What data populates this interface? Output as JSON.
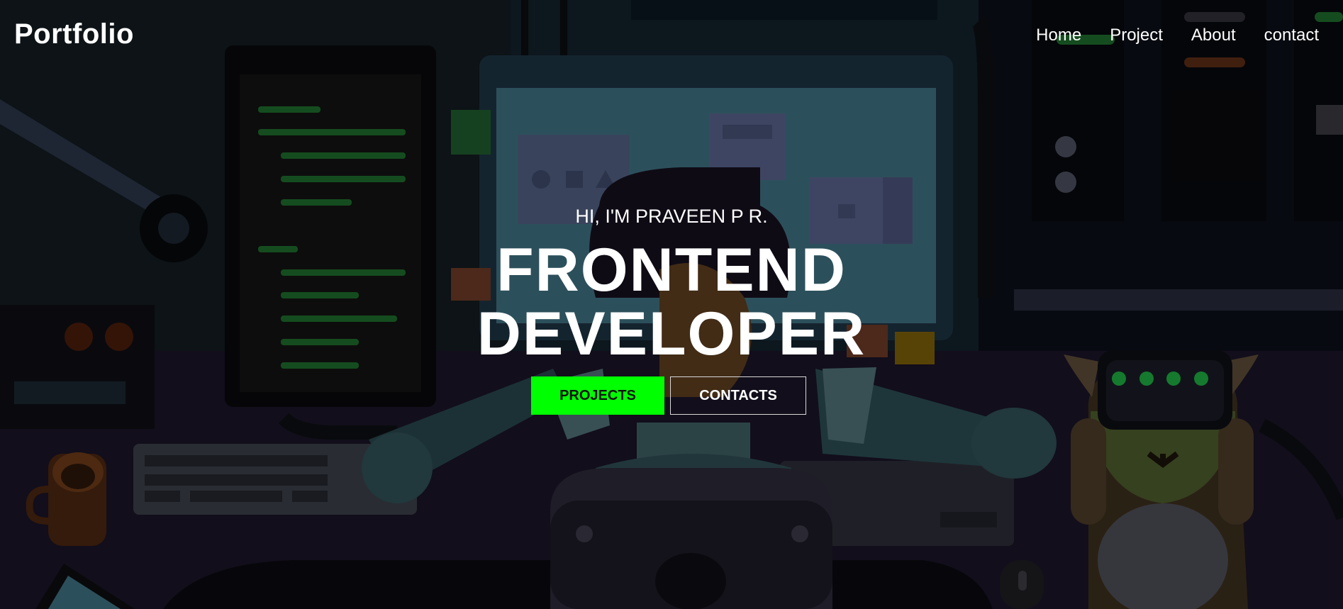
{
  "brand": "Portfolio",
  "nav": [
    {
      "label": "Home"
    },
    {
      "label": "Project"
    },
    {
      "label": "About"
    },
    {
      "label": "contact"
    }
  ],
  "hero": {
    "greeting": "HI, I'M PRAVEEN P R.",
    "title_line1": "FRONTEND",
    "title_line2": "DEVELOPER",
    "primary_button": "PROJECTS",
    "secondary_button": "CONTACTS"
  },
  "colors": {
    "accent": "#00ff00",
    "text": "#ffffff"
  }
}
